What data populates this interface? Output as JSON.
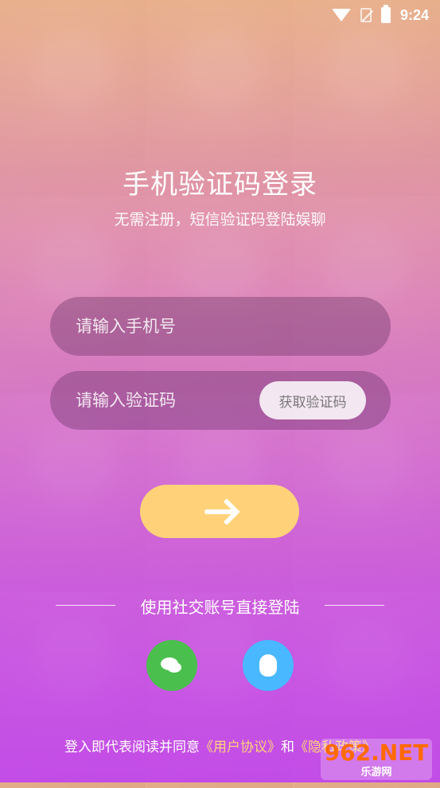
{
  "status": {
    "time": "9:24"
  },
  "header": {
    "title": "手机验证码登录",
    "subtitle": "无需注册，短信验证码登陆娱聊"
  },
  "form": {
    "phone_placeholder": "请输入手机号",
    "code_placeholder": "请输入验证码",
    "get_code_label": "获取验证码"
  },
  "social": {
    "label": "使用社交账号直接登陆"
  },
  "footer": {
    "text_before": "登入即代表阅读并同意",
    "user_agreement": "《用户协议》",
    "and": "和",
    "privacy_policy": "《隐私政策》"
  },
  "watermark": {
    "line1": "962.NET",
    "line2": "乐游网"
  },
  "colors": {
    "accent_yellow": "#ffd27a",
    "wechat_green": "#4bbf4e",
    "qq_blue": "#49b8ff"
  }
}
